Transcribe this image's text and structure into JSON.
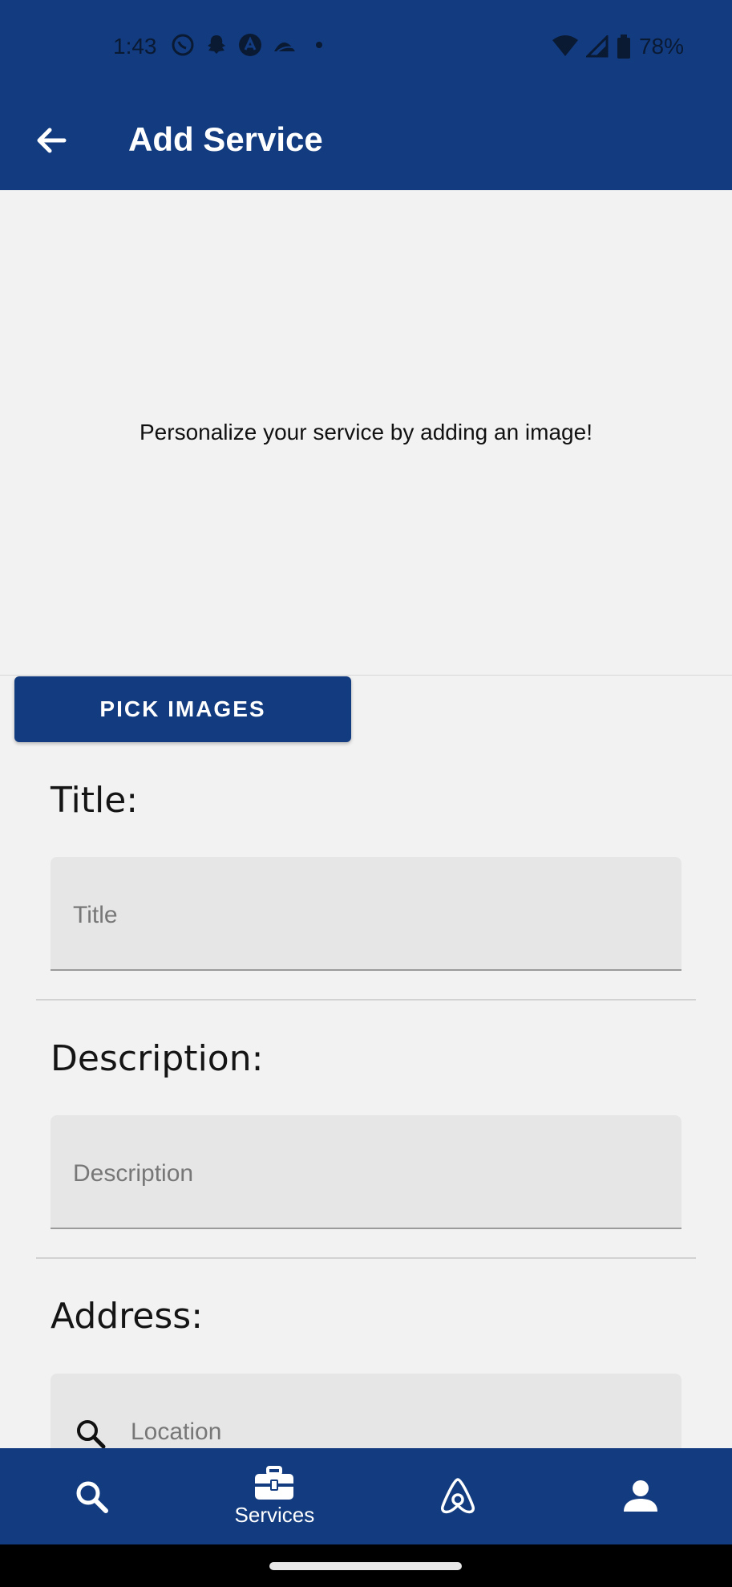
{
  "status_bar": {
    "time": "1:43",
    "battery": "78%"
  },
  "app_bar": {
    "title": "Add Service"
  },
  "image_area": {
    "prompt": "Personalize your service by adding an image!"
  },
  "pick_button": {
    "label": "PICK IMAGES"
  },
  "form": {
    "title_label": "Title:",
    "title_placeholder": "Title",
    "description_label": "Description:",
    "description_placeholder": "Description",
    "address_label": "Address:",
    "location_placeholder": "Location"
  },
  "bottom_nav": {
    "items": [
      {
        "icon": "search-icon",
        "label": ""
      },
      {
        "icon": "briefcase-icon",
        "label": "Services"
      },
      {
        "icon": "airbnb-icon",
        "label": ""
      },
      {
        "icon": "person-icon",
        "label": ""
      }
    ]
  },
  "colors": {
    "primary": "#123b80",
    "background": "#f2f2f2",
    "field": "#e6e6e6"
  }
}
